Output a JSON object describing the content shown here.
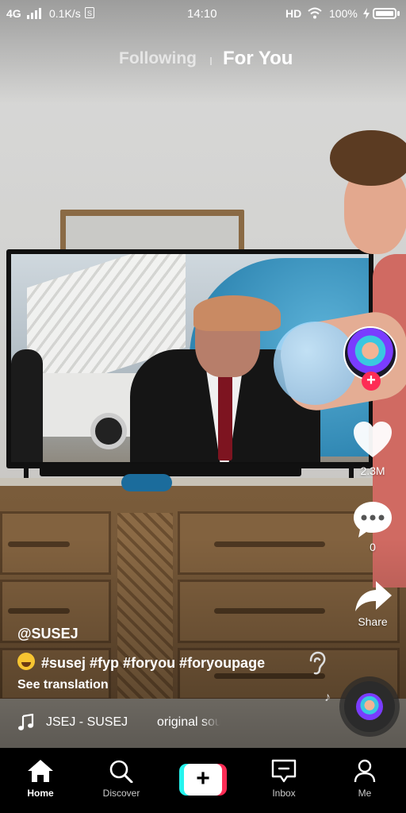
{
  "status_bar": {
    "network": "4G",
    "speed": "0.1K/s",
    "sim": "S",
    "time": "14:10",
    "hd": "HD",
    "battery": "100%"
  },
  "top_tabs": {
    "following": "Following",
    "for_you": "For You",
    "active": "For You"
  },
  "rail": {
    "follow_symbol": "+",
    "likes": "2.3M",
    "comments": "0",
    "share": "Share"
  },
  "post": {
    "username": "@SUSEJ",
    "caption": "#susej #fyp #foryou #foryoupage",
    "emoji": "laughing-face",
    "see_translation": "See translation",
    "sound_title": "JSEJ - SUSEJ",
    "sound_original": "original sound"
  },
  "nav": {
    "home": "Home",
    "discover": "Discover",
    "create_symbol": "+",
    "inbox": "Inbox",
    "me": "Me"
  },
  "colors": {
    "accent_red": "#fe2c55",
    "accent_cyan": "#25f4ee",
    "nav_background": "#000000"
  }
}
